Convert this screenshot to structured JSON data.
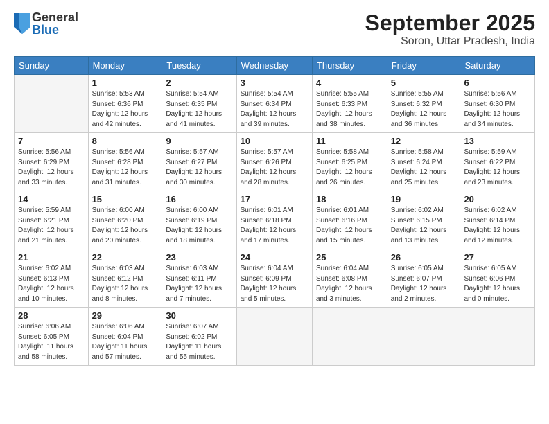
{
  "logo": {
    "general": "General",
    "blue": "Blue"
  },
  "title": "September 2025",
  "subtitle": "Soron, Uttar Pradesh, India",
  "headers": [
    "Sunday",
    "Monday",
    "Tuesday",
    "Wednesday",
    "Thursday",
    "Friday",
    "Saturday"
  ],
  "weeks": [
    [
      {
        "num": "",
        "detail": ""
      },
      {
        "num": "1",
        "detail": "Sunrise: 5:53 AM\nSunset: 6:36 PM\nDaylight: 12 hours\nand 42 minutes."
      },
      {
        "num": "2",
        "detail": "Sunrise: 5:54 AM\nSunset: 6:35 PM\nDaylight: 12 hours\nand 41 minutes."
      },
      {
        "num": "3",
        "detail": "Sunrise: 5:54 AM\nSunset: 6:34 PM\nDaylight: 12 hours\nand 39 minutes."
      },
      {
        "num": "4",
        "detail": "Sunrise: 5:55 AM\nSunset: 6:33 PM\nDaylight: 12 hours\nand 38 minutes."
      },
      {
        "num": "5",
        "detail": "Sunrise: 5:55 AM\nSunset: 6:32 PM\nDaylight: 12 hours\nand 36 minutes."
      },
      {
        "num": "6",
        "detail": "Sunrise: 5:56 AM\nSunset: 6:30 PM\nDaylight: 12 hours\nand 34 minutes."
      }
    ],
    [
      {
        "num": "7",
        "detail": "Sunrise: 5:56 AM\nSunset: 6:29 PM\nDaylight: 12 hours\nand 33 minutes."
      },
      {
        "num": "8",
        "detail": "Sunrise: 5:56 AM\nSunset: 6:28 PM\nDaylight: 12 hours\nand 31 minutes."
      },
      {
        "num": "9",
        "detail": "Sunrise: 5:57 AM\nSunset: 6:27 PM\nDaylight: 12 hours\nand 30 minutes."
      },
      {
        "num": "10",
        "detail": "Sunrise: 5:57 AM\nSunset: 6:26 PM\nDaylight: 12 hours\nand 28 minutes."
      },
      {
        "num": "11",
        "detail": "Sunrise: 5:58 AM\nSunset: 6:25 PM\nDaylight: 12 hours\nand 26 minutes."
      },
      {
        "num": "12",
        "detail": "Sunrise: 5:58 AM\nSunset: 6:24 PM\nDaylight: 12 hours\nand 25 minutes."
      },
      {
        "num": "13",
        "detail": "Sunrise: 5:59 AM\nSunset: 6:22 PM\nDaylight: 12 hours\nand 23 minutes."
      }
    ],
    [
      {
        "num": "14",
        "detail": "Sunrise: 5:59 AM\nSunset: 6:21 PM\nDaylight: 12 hours\nand 21 minutes."
      },
      {
        "num": "15",
        "detail": "Sunrise: 6:00 AM\nSunset: 6:20 PM\nDaylight: 12 hours\nand 20 minutes."
      },
      {
        "num": "16",
        "detail": "Sunrise: 6:00 AM\nSunset: 6:19 PM\nDaylight: 12 hours\nand 18 minutes."
      },
      {
        "num": "17",
        "detail": "Sunrise: 6:01 AM\nSunset: 6:18 PM\nDaylight: 12 hours\nand 17 minutes."
      },
      {
        "num": "18",
        "detail": "Sunrise: 6:01 AM\nSunset: 6:16 PM\nDaylight: 12 hours\nand 15 minutes."
      },
      {
        "num": "19",
        "detail": "Sunrise: 6:02 AM\nSunset: 6:15 PM\nDaylight: 12 hours\nand 13 minutes."
      },
      {
        "num": "20",
        "detail": "Sunrise: 6:02 AM\nSunset: 6:14 PM\nDaylight: 12 hours\nand 12 minutes."
      }
    ],
    [
      {
        "num": "21",
        "detail": "Sunrise: 6:02 AM\nSunset: 6:13 PM\nDaylight: 12 hours\nand 10 minutes."
      },
      {
        "num": "22",
        "detail": "Sunrise: 6:03 AM\nSunset: 6:12 PM\nDaylight: 12 hours\nand 8 minutes."
      },
      {
        "num": "23",
        "detail": "Sunrise: 6:03 AM\nSunset: 6:11 PM\nDaylight: 12 hours\nand 7 minutes."
      },
      {
        "num": "24",
        "detail": "Sunrise: 6:04 AM\nSunset: 6:09 PM\nDaylight: 12 hours\nand 5 minutes."
      },
      {
        "num": "25",
        "detail": "Sunrise: 6:04 AM\nSunset: 6:08 PM\nDaylight: 12 hours\nand 3 minutes."
      },
      {
        "num": "26",
        "detail": "Sunrise: 6:05 AM\nSunset: 6:07 PM\nDaylight: 12 hours\nand 2 minutes."
      },
      {
        "num": "27",
        "detail": "Sunrise: 6:05 AM\nSunset: 6:06 PM\nDaylight: 12 hours\nand 0 minutes."
      }
    ],
    [
      {
        "num": "28",
        "detail": "Sunrise: 6:06 AM\nSunset: 6:05 PM\nDaylight: 11 hours\nand 58 minutes."
      },
      {
        "num": "29",
        "detail": "Sunrise: 6:06 AM\nSunset: 6:04 PM\nDaylight: 11 hours\nand 57 minutes."
      },
      {
        "num": "30",
        "detail": "Sunrise: 6:07 AM\nSunset: 6:02 PM\nDaylight: 11 hours\nand 55 minutes."
      },
      {
        "num": "",
        "detail": ""
      },
      {
        "num": "",
        "detail": ""
      },
      {
        "num": "",
        "detail": ""
      },
      {
        "num": "",
        "detail": ""
      }
    ]
  ]
}
